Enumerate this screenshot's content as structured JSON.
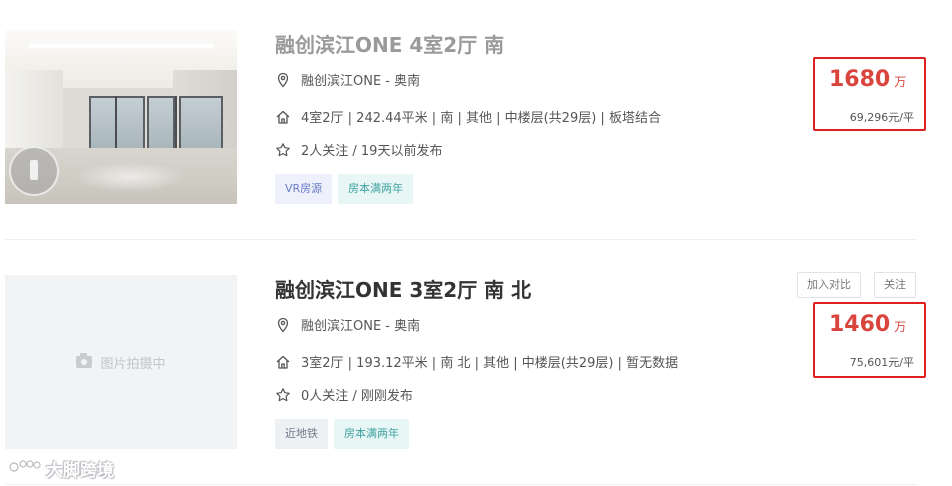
{
  "listings": [
    {
      "title": "融创滨江ONE 4室2厅 南",
      "location": "融创滨江ONE - 奥南",
      "info": "4室2厅 | 242.44平米 | 南 | 其他 | 中楼层(共29层) | 板塔结合",
      "follow": "2人关注 / 19天以前发布",
      "tags": [
        "VR房源",
        "房本满两年"
      ],
      "price_total": "1680",
      "price_total_unit": "万",
      "price_unit": "69,296元/平"
    },
    {
      "title": "融创滨江ONE 3室2厅 南 北",
      "location": "融创滨江ONE - 奥南",
      "info": "3室2厅 | 193.12平米 | 南 北 | 其他 | 中楼层(共29层) | 暂无数据",
      "follow": "0人关注 / 刚刚发布",
      "tags": [
        "近地铁",
        "房本满两年"
      ],
      "price_total": "1460",
      "price_total_unit": "万",
      "price_unit": "75,601元/平",
      "photo_placeholder": "图片拍摄中",
      "compare_label": "加入对比",
      "follow_label": "关注"
    }
  ],
  "watermark": "大脚跨境",
  "icons": {
    "location": "location-pin-icon",
    "house": "house-icon",
    "star": "star-icon",
    "camera": "camera-icon"
  },
  "colors": {
    "price": "#d9453c",
    "highlight_border": "#e02020",
    "tag_vr": "#6b7bc8",
    "tag_green": "#3fa3a1"
  }
}
